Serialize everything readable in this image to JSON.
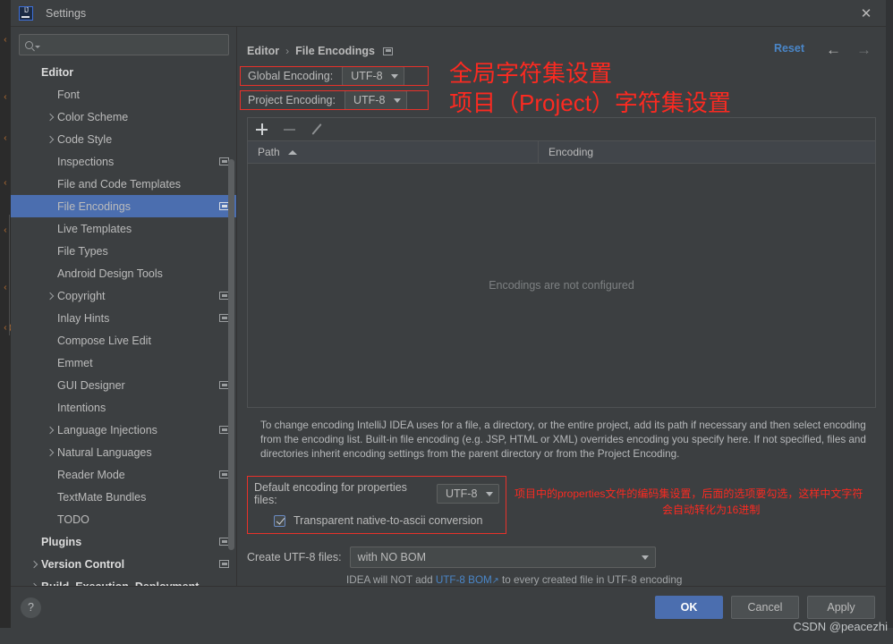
{
  "window": {
    "title": "Settings",
    "logo_text": "IJ",
    "close_label": "✕"
  },
  "search": {
    "value": "",
    "placeholder": ""
  },
  "sidebar": {
    "items": [
      {
        "label": "Editor",
        "level": 0,
        "bold": true,
        "twisty": false,
        "badge": false,
        "selected": false
      },
      {
        "label": "Font",
        "level": 1,
        "bold": false,
        "twisty": false,
        "badge": false,
        "selected": false
      },
      {
        "label": "Color Scheme",
        "level": 1,
        "bold": false,
        "twisty": true,
        "badge": false,
        "selected": false
      },
      {
        "label": "Code Style",
        "level": 1,
        "bold": false,
        "twisty": true,
        "badge": false,
        "selected": false
      },
      {
        "label": "Inspections",
        "level": 1,
        "bold": false,
        "twisty": false,
        "badge": true,
        "selected": false
      },
      {
        "label": "File and Code Templates",
        "level": 1,
        "bold": false,
        "twisty": false,
        "badge": false,
        "selected": false
      },
      {
        "label": "File Encodings",
        "level": 1,
        "bold": false,
        "twisty": false,
        "badge": true,
        "selected": true
      },
      {
        "label": "Live Templates",
        "level": 1,
        "bold": false,
        "twisty": false,
        "badge": false,
        "selected": false
      },
      {
        "label": "File Types",
        "level": 1,
        "bold": false,
        "twisty": false,
        "badge": false,
        "selected": false
      },
      {
        "label": "Android Design Tools",
        "level": 1,
        "bold": false,
        "twisty": false,
        "badge": false,
        "selected": false
      },
      {
        "label": "Copyright",
        "level": 1,
        "bold": false,
        "twisty": true,
        "badge": true,
        "selected": false
      },
      {
        "label": "Inlay Hints",
        "level": 1,
        "bold": false,
        "twisty": false,
        "badge": true,
        "selected": false
      },
      {
        "label": "Compose Live Edit",
        "level": 1,
        "bold": false,
        "twisty": false,
        "badge": false,
        "selected": false
      },
      {
        "label": "Emmet",
        "level": 1,
        "bold": false,
        "twisty": false,
        "badge": false,
        "selected": false
      },
      {
        "label": "GUI Designer",
        "level": 1,
        "bold": false,
        "twisty": false,
        "badge": true,
        "selected": false
      },
      {
        "label": "Intentions",
        "level": 1,
        "bold": false,
        "twisty": false,
        "badge": false,
        "selected": false
      },
      {
        "label": "Language Injections",
        "level": 1,
        "bold": false,
        "twisty": true,
        "badge": true,
        "selected": false
      },
      {
        "label": "Natural Languages",
        "level": 1,
        "bold": false,
        "twisty": true,
        "badge": false,
        "selected": false
      },
      {
        "label": "Reader Mode",
        "level": 1,
        "bold": false,
        "twisty": false,
        "badge": true,
        "selected": false
      },
      {
        "label": "TextMate Bundles",
        "level": 1,
        "bold": false,
        "twisty": false,
        "badge": false,
        "selected": false
      },
      {
        "label": "TODO",
        "level": 1,
        "bold": false,
        "twisty": false,
        "badge": false,
        "selected": false
      },
      {
        "label": "Plugins",
        "level": 0,
        "bold": true,
        "twisty": false,
        "badge": true,
        "selected": false
      },
      {
        "label": "Version Control",
        "level": 0,
        "bold": true,
        "twisty": true,
        "badge": true,
        "selected": false
      },
      {
        "label": "Build, Execution, Deployment",
        "level": 0,
        "bold": true,
        "twisty": true,
        "badge": false,
        "selected": false
      }
    ]
  },
  "breadcrumb": {
    "parent": "Editor",
    "separator": "›",
    "current": "File Encodings"
  },
  "header": {
    "reset_label": "Reset",
    "back_arrow": "←",
    "forward_arrow": "→"
  },
  "encodings": {
    "global_label": "Global Encoding:",
    "global_value": "UTF-8",
    "project_label": "Project Encoding:",
    "project_value": "UTF-8"
  },
  "annotations": {
    "global": "全局字符集设置",
    "project": "项目（Project）字符集设置",
    "properties_line1": "项目中的properties文件的编码集设置，后面的选项要勾选，这样中文字符",
    "properties_line2": "会自动转化为16进制",
    "color": "#fb2a21"
  },
  "table": {
    "toolbar": {
      "add_label": "+",
      "remove_label": "−",
      "edit_label": "edit"
    },
    "columns": [
      "Path",
      "Encoding"
    ],
    "sort_column": "Path",
    "sort_direction": "asc",
    "rows": [],
    "empty_message": "Encodings are not configured"
  },
  "description": "To change encoding IntelliJ IDEA uses for a file, a directory, or the entire project, add its path if necessary and then select encoding from the encoding list. Built-in file encoding (e.g. JSP, HTML or XML) overrides encoding you specify here. If not specified, files and directories inherit encoding settings from the parent directory or from the Project Encoding.",
  "properties": {
    "label": "Default encoding for properties files:",
    "value": "UTF-8",
    "checkbox_label": "Transparent native-to-ascii conversion",
    "checkbox_checked": true
  },
  "create_utf8": {
    "label": "Create UTF-8 files:",
    "value": "with NO BOM",
    "hint_prefix": "IDEA will NOT add ",
    "hint_link": "UTF-8 BOM",
    "hint_link_icon": "↗",
    "hint_suffix": " to every created file in UTF-8 encoding"
  },
  "footer": {
    "help_label": "?",
    "ok_label": "OK",
    "cancel_label": "Cancel",
    "apply_label": "Apply"
  },
  "watermark": "CSDN @peacezhi",
  "background_code": [
    "‹",
    "‹",
    "‹",
    "‹",
    "‹",
    "‹",
    "‹("
  ],
  "colors": {
    "accent": "#4b6eaf",
    "link": "#4a86c8",
    "annotation": "#fb2a21",
    "panel": "#3c3f41",
    "field": "#45494a"
  }
}
